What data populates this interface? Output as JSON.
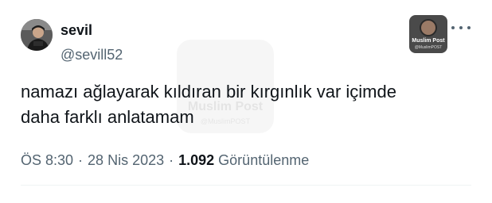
{
  "author": {
    "display_name": "sevil",
    "handle": "@sevill52"
  },
  "watermark": {
    "title": "Muslim Post",
    "subtitle": "@MuslimPOST"
  },
  "tweet": {
    "text": "namazı ağlayarak kıldıran bir kırgınlık var içimde\ndaha farklı anlatamam"
  },
  "meta": {
    "time": "ÖS 8:30",
    "date": "28 Nis 2023",
    "separator": "·",
    "views_count": "1.092",
    "views_label": "Görüntülenme"
  },
  "icons": {
    "avatar": "user-avatar",
    "more": "more-horizontal-icon"
  }
}
